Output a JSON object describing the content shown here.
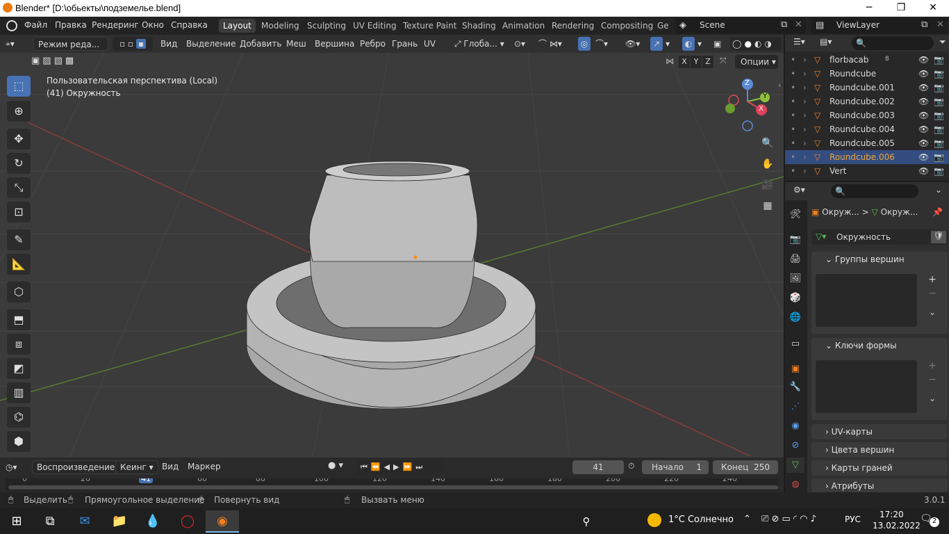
{
  "window": {
    "title": "Blender* [D:\\обьекты\\подземелье.blend]",
    "controls": [
      "─",
      "❐",
      "✕"
    ]
  },
  "menu": {
    "items": [
      "Файл",
      "Правка",
      "Рендеринг",
      "Окно",
      "Справка"
    ],
    "workspaces": [
      "Layout",
      "Modeling",
      "Sculpting",
      "UV Editing",
      "Texture Paint",
      "Shading",
      "Animation",
      "Rendering",
      "Compositing",
      "Ge"
    ],
    "scene": "Scene",
    "view_layer": "ViewLayer"
  },
  "header": {
    "mode": "Режим реда...",
    "items": [
      "Вид",
      "Выделение",
      "Добавить",
      "Меш",
      "Вершина",
      "Ребро",
      "Грань",
      "UV"
    ],
    "orientation": "Глоба...",
    "axes": [
      "X",
      "Y",
      "Z"
    ],
    "options": "Опции"
  },
  "viewport": {
    "perspective": "Пользовательская перспектива (Local)",
    "object": "(41) Окружность",
    "gizmo": {
      "z": "Z",
      "y": "Y",
      "x": "X"
    }
  },
  "outliner": {
    "rows": [
      {
        "name": "florbacab",
        "sel": false,
        "badge": "8"
      },
      {
        "name": "Roundcube",
        "sel": false
      },
      {
        "name": "Roundcube.001",
        "sel": false
      },
      {
        "name": "Roundcube.002",
        "sel": false
      },
      {
        "name": "Roundcube.003",
        "sel": false
      },
      {
        "name": "Roundcube.004",
        "sel": false
      },
      {
        "name": "Roundcube.005",
        "sel": false
      },
      {
        "name": "Roundcube.006",
        "sel": true
      },
      {
        "name": "Vert",
        "sel": false
      }
    ]
  },
  "properties": {
    "breadcrumb": [
      "Окруж...",
      "Окруж..."
    ],
    "datablock": "Окружность",
    "panels": [
      "Группы вершин",
      "Ключи формы",
      "UV-карты",
      "Цвета вершин",
      "Карты граней",
      "Атрибуты"
    ]
  },
  "timeline": {
    "menus": [
      "Воспроизведение",
      "Кеинг",
      "Вид",
      "Маркер"
    ],
    "current_frame": "41",
    "start_label": "Начало",
    "start": "1",
    "end_label": "Конец",
    "end": "250",
    "ruler": [
      "0",
      "20",
      "41",
      "60",
      "80",
      "100",
      "120",
      "140",
      "160",
      "180",
      "200",
      "220",
      "240"
    ]
  },
  "status": {
    "select": "Выделить",
    "box": "Прямоугольное выделение",
    "rotate": "Повернуть вид",
    "menu": "Вызвать меню",
    "version": "3.0.1"
  },
  "taskbar": {
    "weather": "1°C Солнечно",
    "lang": "РУС",
    "time": "17:20",
    "date": "13.02.2022",
    "notif": "2"
  }
}
